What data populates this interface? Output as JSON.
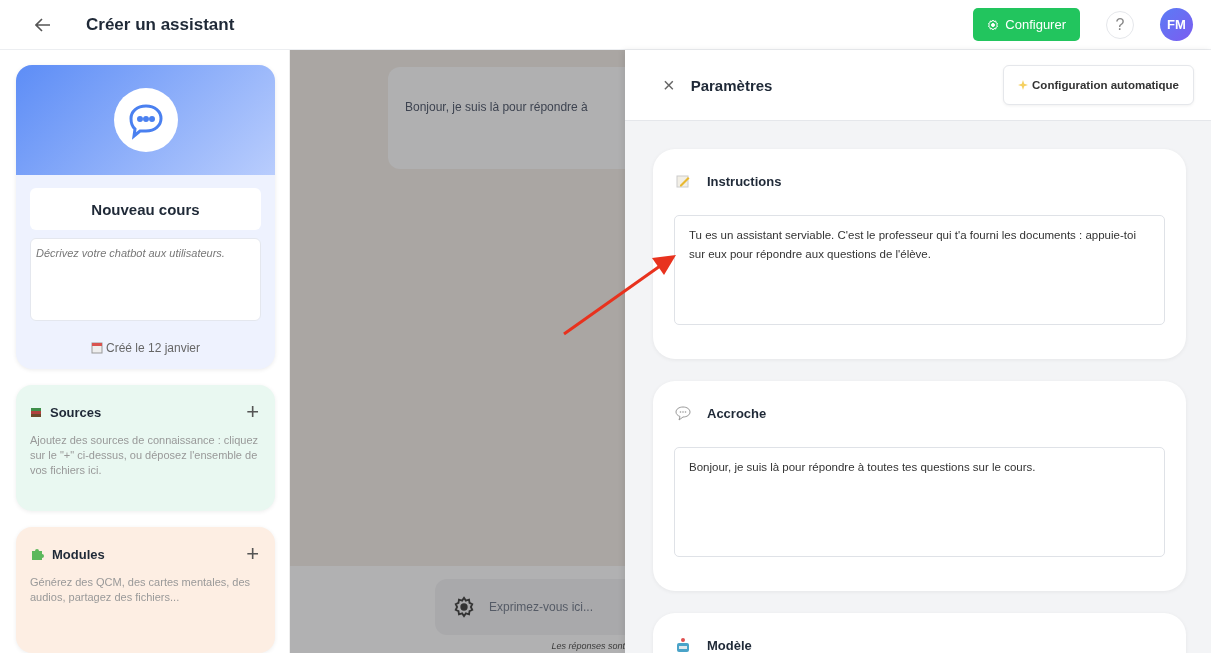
{
  "header": {
    "title": "Créer un assistant",
    "configure_button": "Configurer",
    "help_button": "?",
    "avatar": "FM"
  },
  "assistant_card": {
    "name": "Nouveau cours",
    "description_placeholder": "Décrivez votre chatbot aux utilisateurs.",
    "created": "Créé le 12 janvier"
  },
  "side_sections": [
    {
      "kind": "sources",
      "title": "Sources",
      "add": "+",
      "text": "Ajoutez des sources de connaissance : cliquez sur le \"+\" ci-dessus, ou déposez l'ensemble de vos fichiers ici.",
      "color": "#e9f8f1"
    },
    {
      "kind": "modules",
      "title": "Modules",
      "add": "+",
      "text": "Générez des QCM, des cartes mentales, des audios, partagez des fichiers...",
      "color": "#fdeee3"
    }
  ],
  "chat": {
    "message": "Bonjour, je suis là pour répondre à",
    "input_placeholder": "Exprimez-vous ici...",
    "footer_note": "Les réponses sont"
  },
  "settings_panel": {
    "close": "×",
    "title": "Paramètres",
    "auto_button": "Configuration automatique",
    "sections": [
      {
        "kind": "instructions",
        "title": "Instructions",
        "value": "Tu es un assistant serviable. C'est le professeur qui t'a fourni les documents : appuie-toi sur eux pour répondre aux questions de l'élève."
      },
      {
        "kind": "hook",
        "title": "Accroche",
        "value": "Bonjour, je suis là pour répondre à toutes tes questions sur le cours."
      },
      {
        "kind": "model",
        "title": "Modèle"
      }
    ]
  }
}
